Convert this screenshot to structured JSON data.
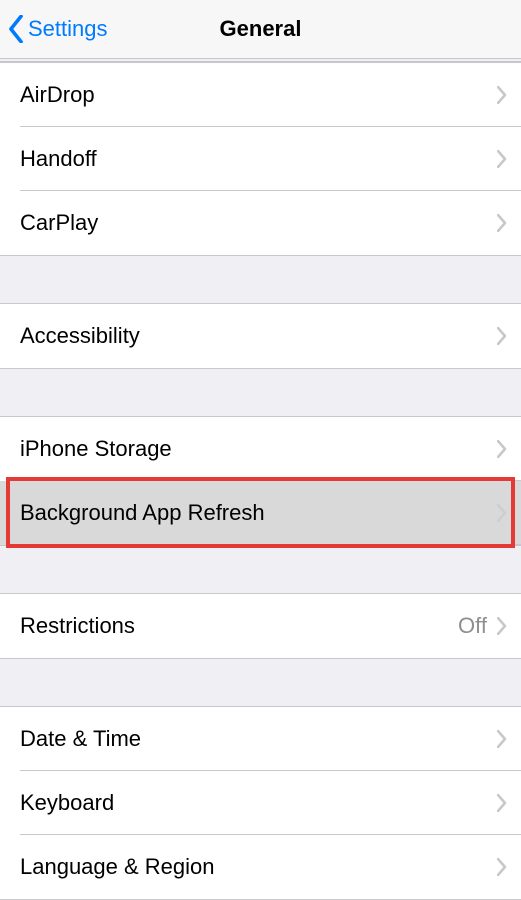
{
  "header": {
    "back_label": "Settings",
    "title": "General"
  },
  "groups": [
    {
      "rows": [
        {
          "label": "AirDrop",
          "name": "row-airdrop"
        },
        {
          "label": "Handoff",
          "name": "row-handoff"
        },
        {
          "label": "CarPlay",
          "name": "row-carplay"
        }
      ]
    },
    {
      "rows": [
        {
          "label": "Accessibility",
          "name": "row-accessibility"
        }
      ]
    },
    {
      "rows": [
        {
          "label": "iPhone Storage",
          "name": "row-iphone-storage"
        },
        {
          "label": "Background App Refresh",
          "name": "row-background-app-refresh",
          "highlighted": true
        }
      ]
    },
    {
      "rows": [
        {
          "label": "Restrictions",
          "name": "row-restrictions",
          "value": "Off"
        }
      ]
    },
    {
      "rows": [
        {
          "label": "Date & Time",
          "name": "row-date-time"
        },
        {
          "label": "Keyboard",
          "name": "row-keyboard"
        },
        {
          "label": "Language & Region",
          "name": "row-language-region"
        }
      ]
    }
  ]
}
